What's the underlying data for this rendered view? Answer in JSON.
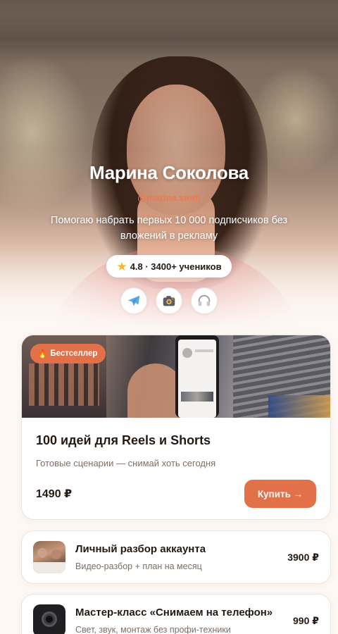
{
  "profile": {
    "name": "Марина Соколова",
    "handle": "@marina.smm",
    "bio": "Помогаю набрать первых 10 000 подписчиков без вложений в рекламу",
    "rating": "4.8 · 3400+ учеников",
    "rating_icon": "star-icon",
    "socials": [
      {
        "icon": "telegram-plane-icon"
      },
      {
        "icon": "camera-icon"
      },
      {
        "icon": "headphones-icon"
      }
    ]
  },
  "featured": {
    "badge": "Бестселлер",
    "badge_icon": "fire-icon",
    "title": "100 идей для Reels и Shorts",
    "subtitle": "Готовые сценарии — снимай хоть сегодня",
    "price": "1490 ₽",
    "buy_label": "Купить →"
  },
  "products": [
    {
      "title": "Личный разбор аккаунта",
      "subtitle": "Видео-разбор + план на месяц",
      "price": "3900 ₽"
    },
    {
      "title": "Мастер-класс «Снимаем на телефон»",
      "subtitle": "Свет, звук, монтаж без профи-техники",
      "price": "990 ₽"
    }
  ],
  "colors": {
    "accent": "#e2714a",
    "handle": "#ec7a4e",
    "background": "#fdf8f4",
    "text": "#241a14",
    "muted": "#7e6e64"
  }
}
